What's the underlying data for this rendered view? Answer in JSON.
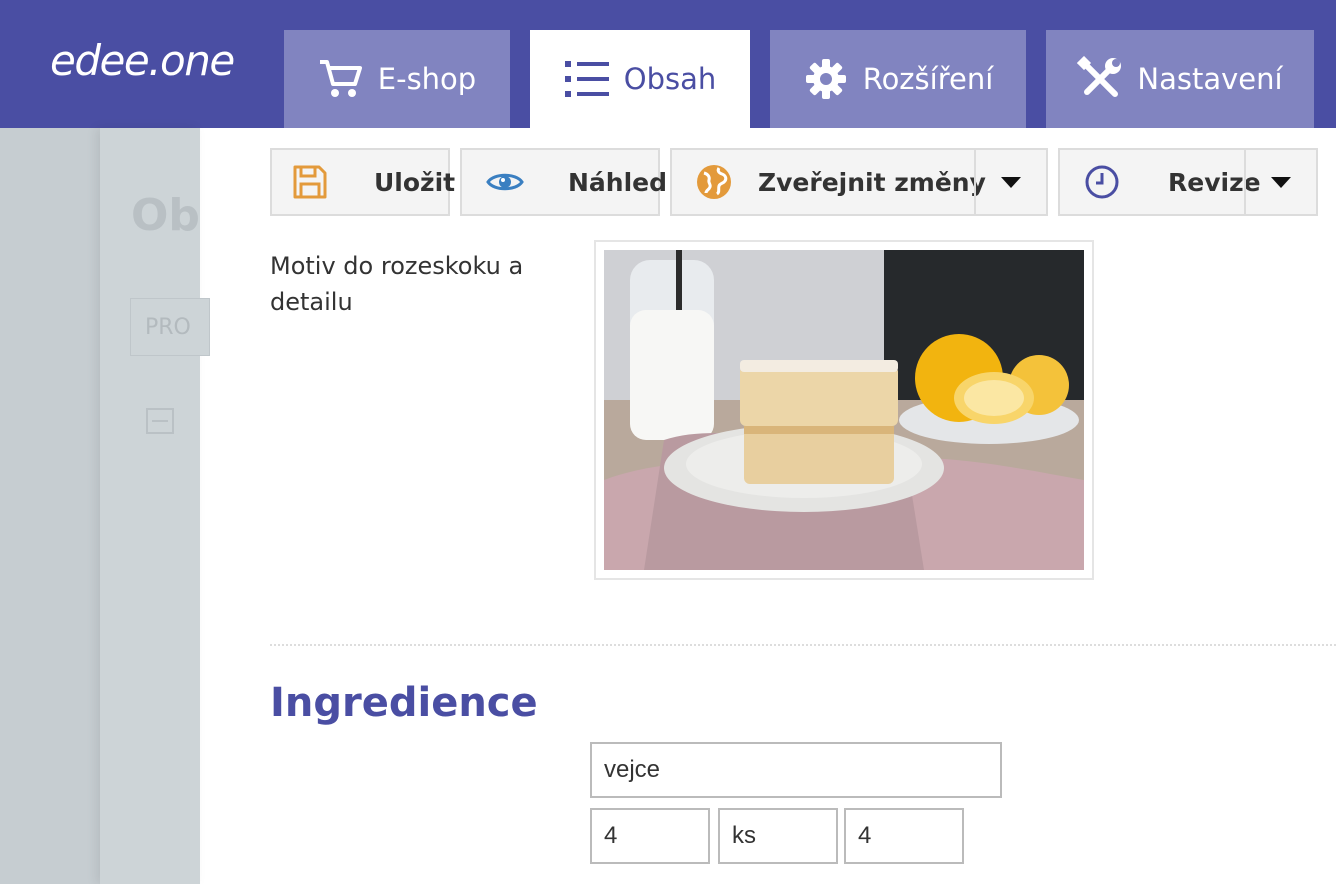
{
  "brand": {
    "logo_text": "edee.one"
  },
  "nav": {
    "tabs": [
      {
        "label": "E-shop",
        "icon": "cart-icon",
        "active": false
      },
      {
        "label": "Obsah",
        "icon": "list-icon",
        "active": true
      },
      {
        "label": "Rozšíření",
        "icon": "gear-icon",
        "active": false
      },
      {
        "label": "Nastavení",
        "icon": "wrench-screwdriver-icon",
        "active": false
      }
    ]
  },
  "background": {
    "title_fragment": "Ob",
    "input_fragment": "PRO"
  },
  "toolbar": {
    "save_label": "Uložit",
    "preview_label": "Náhled",
    "publish_label": "Zveřejnit změny",
    "revisions_label": "Revize"
  },
  "form": {
    "image_label": "Motiv do rozeskoku a detailu",
    "section_title": "Ingredience",
    "ingredient_name": "vejce",
    "ingredient_amount": "4",
    "ingredient_unit": "ks",
    "ingredient_count": "4"
  },
  "colors": {
    "brand": "#4a4ea3",
    "tab_inactive": "#8184c0",
    "save_icon": "#e39a3b",
    "preview_icon": "#3a7fc1",
    "publish_icon": "#e39a3b",
    "revisions_icon": "#4a4ea3"
  }
}
